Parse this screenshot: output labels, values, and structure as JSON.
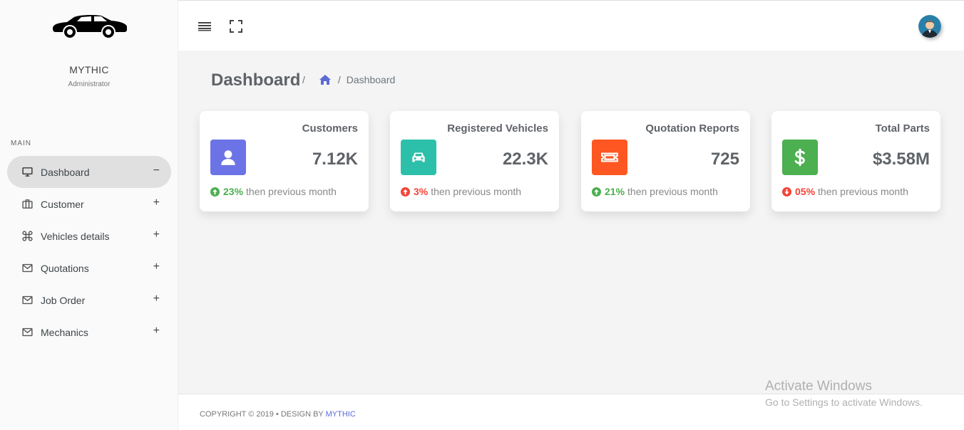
{
  "brand": {
    "name": "MYTHIC",
    "role": "Administrator"
  },
  "sidebar": {
    "section": "MAIN",
    "items": [
      {
        "label": "Dashboard",
        "icon": "monitor-icon",
        "toggle": "−",
        "active": true
      },
      {
        "label": "Customer",
        "icon": "briefcase-icon",
        "toggle": "+"
      },
      {
        "label": "Vehicles details",
        "icon": "command-icon",
        "toggle": "+"
      },
      {
        "label": "Quotations",
        "icon": "mail-icon",
        "toggle": "+"
      },
      {
        "label": "Job Order",
        "icon": "mail-icon",
        "toggle": "+"
      },
      {
        "label": "Mechanics",
        "icon": "mail-icon",
        "toggle": "+"
      }
    ]
  },
  "page": {
    "title": "Dashboard",
    "breadcrumb": {
      "sep": "/",
      "current": "Dashboard"
    }
  },
  "cards": [
    {
      "title": "Customers",
      "value": "7.12K",
      "icon": "user-icon",
      "color": "#6c73e6",
      "trend": "up",
      "pct": "23%",
      "note": "then previous month",
      "trend_color": "#4caf50"
    },
    {
      "title": "Registered Vehicles",
      "value": "22.3K",
      "icon": "car-icon",
      "color": "#2cbfa9",
      "trend": "down",
      "pct": "3%",
      "note": "then previous month",
      "trend_color": "#f44336"
    },
    {
      "title": "Quotation Reports",
      "value": "725",
      "icon": "ticket-icon",
      "color": "#fe5722",
      "trend": "up",
      "pct": "21%",
      "note": "then previous month",
      "trend_color": "#4caf50"
    },
    {
      "title": "Total Parts",
      "value": "$3.58M",
      "icon": "dollar-icon",
      "color": "#4caf50",
      "trend": "down",
      "pct": "05%",
      "note": "then previous month",
      "trend_color": "#f44336"
    }
  ],
  "footer": {
    "text": "COPYRIGHT © 2019  •  DESIGN BY ",
    "link": "MYTHIC"
  },
  "watermark": {
    "line1": "Activate Windows",
    "line2": "Go to Settings to activate Windows."
  }
}
